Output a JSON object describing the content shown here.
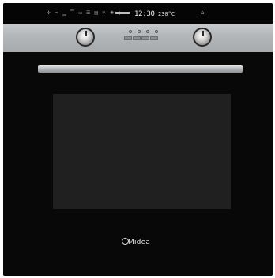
{
  "display": {
    "mode_icons": [
      "fan-icon",
      "grill-icon",
      "bottom-heat-icon",
      "top-heat-icon",
      "top-bottom-heat-icon",
      "fan-grill-icon",
      "fan-heat-icon",
      "defrost-icon",
      "light-icon",
      "eco-icon"
    ],
    "clock": "12:30",
    "temperature": "230°C"
  },
  "logo": {
    "text": "Midea"
  }
}
